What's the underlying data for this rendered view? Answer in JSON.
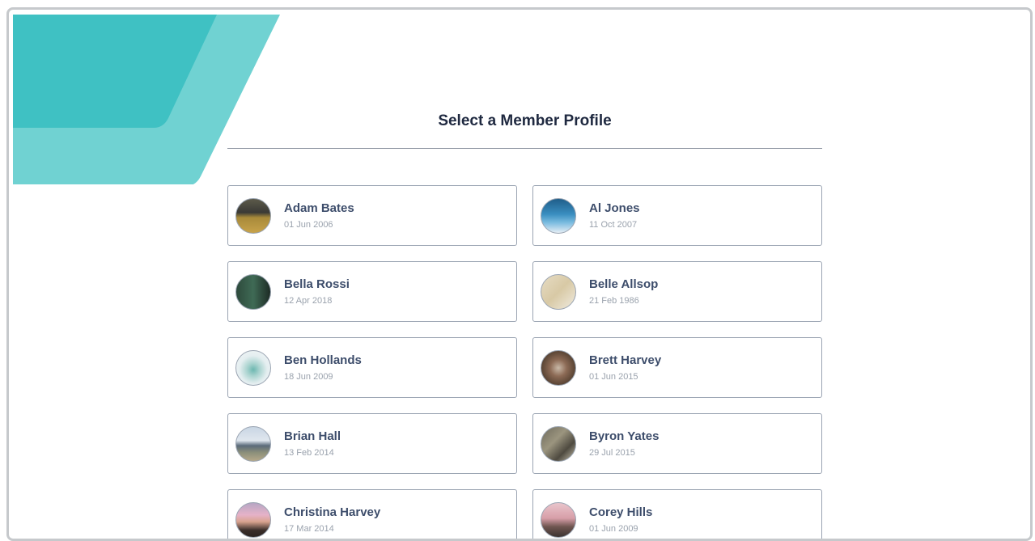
{
  "page": {
    "title": "Select a Member Profile"
  },
  "colors": {
    "accent_dark": "#3fc1c3",
    "accent_light": "#70d2d2",
    "name_text": "#3d4d6b",
    "date_text": "#9aa2ad"
  },
  "members": [
    {
      "name": "Adam Bates",
      "dob": "01 Jun 2006",
      "avatar": "photo-sports-court"
    },
    {
      "name": "Al Jones",
      "dob": "11 Oct 2007",
      "avatar": "photo-sky-jump"
    },
    {
      "name": "Bella Rossi",
      "dob": "12 Apr 2018",
      "avatar": "photo-dark-green"
    },
    {
      "name": "Belle Allsop",
      "dob": "21 Feb 1986",
      "avatar": "photo-beige-room"
    },
    {
      "name": "Ben Hollands",
      "dob": "18 Jun 2009",
      "avatar": "photo-light-person"
    },
    {
      "name": "Brett Harvey",
      "dob": "01 Jun 2015",
      "avatar": "photo-basketball"
    },
    {
      "name": "Brian Hall",
      "dob": "13 Feb 2014",
      "avatar": "photo-landscape-runner"
    },
    {
      "name": "Byron Yates",
      "dob": "29 Jul 2015",
      "avatar": "photo-rock-climber"
    },
    {
      "name": "Christina Harvey",
      "dob": "17 Mar 2014",
      "avatar": "photo-goggles"
    },
    {
      "name": "Corey Hills",
      "dob": "01 Jun 2009",
      "avatar": "photo-cyclist"
    }
  ]
}
